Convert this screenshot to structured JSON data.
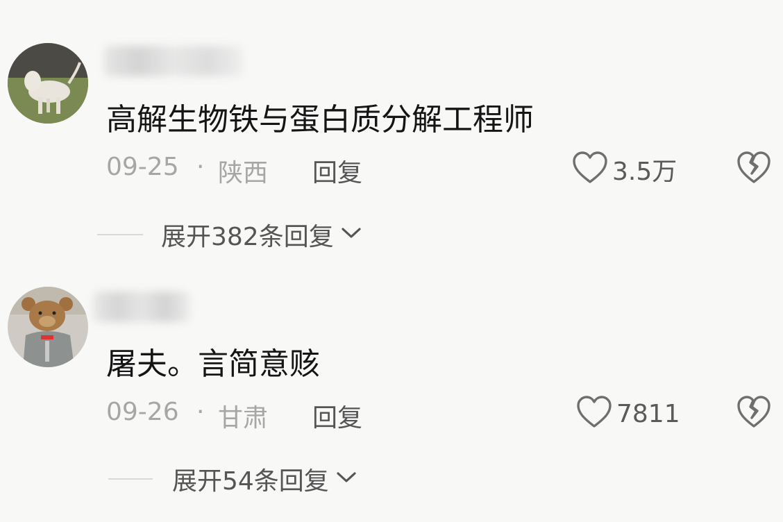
{
  "comments": [
    {
      "username": "",
      "text": "高解生物铁与蛋白质分解工程师",
      "date": "09-25",
      "separator": "·",
      "location": "陕西",
      "reply_label": "回复",
      "like_count": "3.5万",
      "expand_label": "展开382条回复",
      "avatar_icon": "dog-avatar",
      "like_icon": "heart-outline-icon",
      "dislike_icon": "broken-heart-icon",
      "expand_icon": "chevron-down-icon"
    },
    {
      "username": "",
      "text": "屠夫。言简意赅",
      "date": "09-26",
      "separator": "·",
      "location": "甘肃",
      "reply_label": "回复",
      "like_count": "7811",
      "expand_label": "展开54条回复",
      "avatar_icon": "teddy-bear-avatar",
      "like_icon": "heart-outline-icon",
      "dislike_icon": "broken-heart-icon",
      "expand_icon": "chevron-down-icon"
    }
  ],
  "colors": {
    "background": "#f8f8f6",
    "text_primary": "#151515",
    "text_meta": "#a6a6a6",
    "text_secondary": "#555555"
  }
}
